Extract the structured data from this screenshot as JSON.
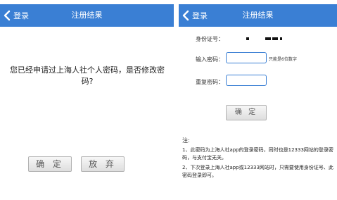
{
  "left": {
    "nav": {
      "back_label": "登录",
      "title": "注册结果"
    },
    "prompt": "您已经申请过上海人社个人密码，是否修改密码?",
    "buttons": {
      "confirm": "确 定",
      "abandon": "放 弃"
    }
  },
  "right": {
    "nav": {
      "back_label": "登录",
      "title": "注册结果"
    },
    "form": {
      "id_label": "身份证号：",
      "password_label": "输入密码：",
      "password_hint": "只能是6位数字",
      "repeat_label": "重复密码：",
      "confirm": "确 定"
    },
    "notes": {
      "title": "注:",
      "line1": "1、此密码为上海人社app的登录密码，同时也是12333网站的登录密码，与支付宝无关。",
      "line2": "2、下次登录上海人社app或12333网站时，只需要使用身份证号、此密码登录即可。"
    }
  },
  "colors": {
    "nav_bar": "#3a7fd4",
    "input_border": "#3a7fd4"
  }
}
